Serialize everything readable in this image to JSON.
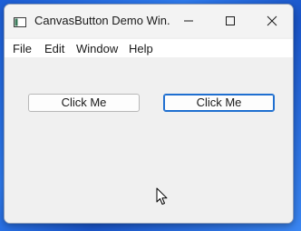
{
  "window": {
    "title": "CanvasButton Demo Win...",
    "controls": {
      "minimize": "minimize-icon",
      "maximize": "maximize-icon",
      "close": "close-icon"
    }
  },
  "menubar": {
    "items": [
      "File",
      "Edit",
      "Window",
      "Help"
    ]
  },
  "content": {
    "buttons": [
      {
        "label": "Click Me",
        "focused": false
      },
      {
        "label": "Click Me",
        "focused": true
      }
    ]
  },
  "colors": {
    "desktop": "#2f7cf0",
    "window_bg": "#f0f0f0",
    "focus_border": "#1f6fd0"
  }
}
